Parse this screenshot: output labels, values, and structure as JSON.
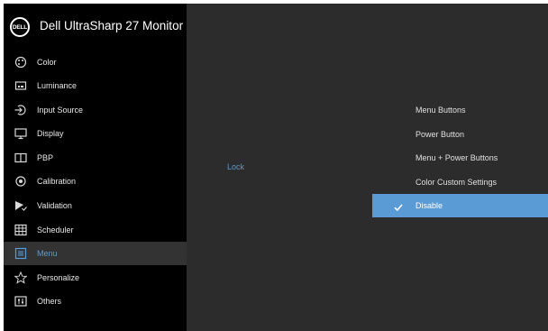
{
  "header": {
    "logo_text": "DELL",
    "model": "Dell UltraSharp 27 Monitor"
  },
  "sidebar": {
    "items": [
      {
        "label": "Color",
        "icon": "color-palette-icon"
      },
      {
        "label": "Luminance",
        "icon": "luminance-icon"
      },
      {
        "label": "Input Source",
        "icon": "input-source-icon"
      },
      {
        "label": "Display",
        "icon": "display-icon"
      },
      {
        "label": "PBP",
        "icon": "pbp-icon"
      },
      {
        "label": "Calibration",
        "icon": "calibration-icon"
      },
      {
        "label": "Validation",
        "icon": "validation-icon"
      },
      {
        "label": "Scheduler",
        "icon": "scheduler-icon"
      },
      {
        "label": "Menu",
        "icon": "menu-icon",
        "active": true
      },
      {
        "label": "Personalize",
        "icon": "star-icon"
      },
      {
        "label": "Others",
        "icon": "others-icon"
      }
    ]
  },
  "submenu": {
    "label": "Lock"
  },
  "options": {
    "items": [
      {
        "label": "Menu Buttons"
      },
      {
        "label": "Power Button"
      },
      {
        "label": "Menu + Power Buttons"
      },
      {
        "label": "Color Custom Settings"
      },
      {
        "label": "Disable",
        "selected": true
      }
    ]
  },
  "colors": {
    "accent": "#5b9bd5",
    "sidebar_bg": "#000000",
    "content_bg": "#2c2c2c",
    "active_item_bg": "#333333"
  }
}
